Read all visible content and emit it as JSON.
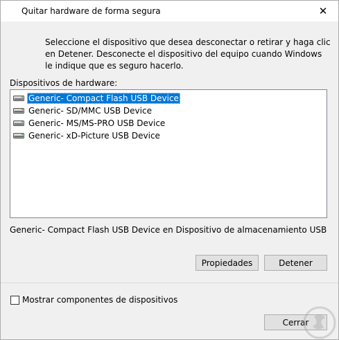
{
  "window": {
    "title": "Quitar hardware de forma segura",
    "close_glyph": "✕"
  },
  "instructions": "Seleccione el dispositivo que desea desconectar o retirar y haga clic en Detener. Desconecte el dispositivo del equipo cuando Windows le indique que es seguro hacerlo.",
  "device_list": {
    "label": "Dispositivos de hardware:",
    "items": [
      {
        "label": "Generic- Compact Flash USB Device",
        "icon": "usb-drive-icon",
        "selected": true
      },
      {
        "label": "Generic- SD/MMC USB Device",
        "icon": "usb-drive-icon",
        "selected": false
      },
      {
        "label": "Generic- MS/MS-PRO USB Device",
        "icon": "usb-drive-icon",
        "selected": false
      },
      {
        "label": "Generic- xD-Picture USB Device",
        "icon": "usb-drive-icon",
        "selected": false
      }
    ]
  },
  "status": "Generic- Compact Flash USB Device en Dispositivo de almacenamiento USB",
  "buttons": {
    "properties": "Propiedades",
    "stop": "Detener",
    "close": "Cerrar"
  },
  "checkbox": {
    "label": "Mostrar componentes de dispositivos",
    "checked": false
  },
  "colors": {
    "selection": "#0078d7",
    "button_bg": "#e1e1e1",
    "dialog_bg": "#f0f0f0"
  }
}
